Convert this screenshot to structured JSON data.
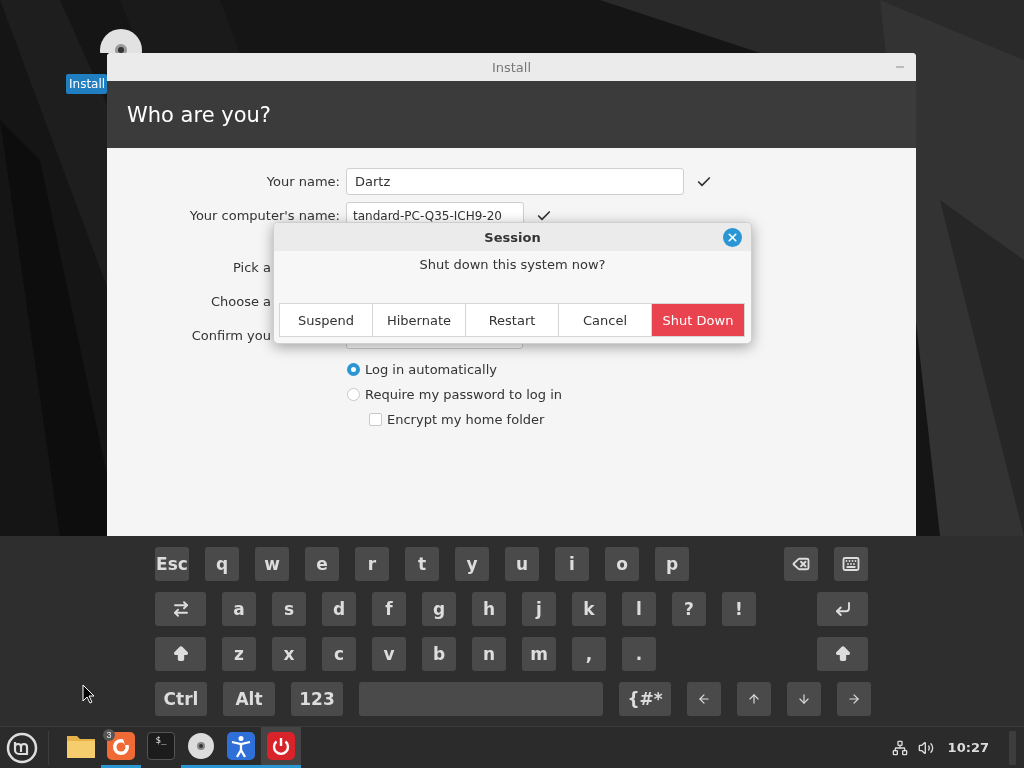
{
  "desktop": {
    "icon_label": "Install"
  },
  "window": {
    "title": "Install",
    "heading": "Who are you?",
    "form": [
      {
        "label": "Your name:",
        "kind": "field",
        "value": "Dartz",
        "valid": true
      },
      {
        "label": "Your computer's name:",
        "kind": "short",
        "value": "tandard-PC-Q35-ICH9-20",
        "valid": true
      },
      {
        "label": "Pick a",
        "kind": "hidden"
      },
      {
        "label": "Choose a",
        "kind": "hidden"
      },
      {
        "label": "Confirm you",
        "kind": "under"
      }
    ],
    "options": [
      {
        "label": "Log in automatically",
        "kind": "radio",
        "selected": true
      },
      {
        "label": "Require my password to log in",
        "kind": "radio",
        "selected": false
      },
      {
        "label": "Encrypt my home folder",
        "kind": "checkbox",
        "checked": false
      }
    ]
  },
  "dialog": {
    "title": "Session",
    "message": "Shut down this system now?",
    "buttons": [
      {
        "label": "Suspend",
        "destructive": false
      },
      {
        "label": "Hibernate",
        "destructive": false
      },
      {
        "label": "Restart",
        "destructive": false
      },
      {
        "label": "Cancel",
        "destructive": false
      },
      {
        "label": "Shut Down",
        "destructive": true
      }
    ]
  },
  "keyboard": {
    "rows": [
      {
        "left": [
          {
            "label": "Esc",
            "kind": "text"
          },
          {
            "label": "q",
            "kind": "text"
          },
          {
            "label": "w",
            "kind": "text"
          },
          {
            "label": "e",
            "kind": "text"
          },
          {
            "label": "r",
            "kind": "text"
          },
          {
            "label": "t",
            "kind": "text"
          },
          {
            "label": "y",
            "kind": "text"
          },
          {
            "label": "u",
            "kind": "text"
          },
          {
            "label": "i",
            "kind": "text"
          },
          {
            "label": "o",
            "kind": "text"
          },
          {
            "label": "p",
            "kind": "text"
          }
        ],
        "right": [
          {
            "kind": "backspace"
          },
          {
            "kind": "keyboard"
          }
        ]
      },
      {
        "left": [
          {
            "kind": "tab"
          },
          {
            "label": "a",
            "kind": "text"
          },
          {
            "label": "s",
            "kind": "text"
          },
          {
            "label": "d",
            "kind": "text"
          },
          {
            "label": "f",
            "kind": "text"
          },
          {
            "label": "g",
            "kind": "text"
          },
          {
            "label": "h",
            "kind": "text"
          },
          {
            "label": "j",
            "kind": "text"
          },
          {
            "label": "k",
            "kind": "text"
          },
          {
            "label": "l",
            "kind": "text"
          },
          {
            "label": "?",
            "kind": "text"
          },
          {
            "label": "!",
            "kind": "text"
          }
        ],
        "right": [
          {
            "kind": "enter"
          }
        ]
      },
      {
        "left": [
          {
            "kind": "shift"
          },
          {
            "label": "z",
            "kind": "text"
          },
          {
            "label": "x",
            "kind": "text"
          },
          {
            "label": "c",
            "kind": "text"
          },
          {
            "label": "v",
            "kind": "text"
          },
          {
            "label": "b",
            "kind": "text"
          },
          {
            "label": "n",
            "kind": "text"
          },
          {
            "label": "m",
            "kind": "text"
          },
          {
            "label": ",",
            "kind": "text"
          },
          {
            "label": ".",
            "kind": "text"
          }
        ],
        "right": [
          {
            "kind": "shift"
          }
        ]
      },
      {
        "left": [
          {
            "label": "Ctrl",
            "kind": "mod"
          },
          {
            "label": "Alt",
            "kind": "mod"
          },
          {
            "label": "123",
            "kind": "mod"
          },
          {
            "kind": "space"
          },
          {
            "label": "{#*",
            "kind": "mod"
          },
          {
            "kind": "left"
          },
          {
            "kind": "up"
          },
          {
            "kind": "down"
          },
          {
            "kind": "right"
          }
        ],
        "right": []
      }
    ]
  },
  "taskbar": {
    "launchers": [
      {
        "kind": "folder",
        "running": false,
        "selected": false
      },
      {
        "kind": "firefox",
        "running": true,
        "selected": false,
        "badge": "3"
      },
      {
        "kind": "terminal",
        "running": false,
        "selected": false,
        "label": "$_"
      },
      {
        "kind": "disc",
        "running": true,
        "selected": false
      },
      {
        "kind": "accessibility",
        "running": true,
        "selected": false
      },
      {
        "kind": "power",
        "running": true,
        "selected": true
      }
    ],
    "clock": "10:27"
  }
}
